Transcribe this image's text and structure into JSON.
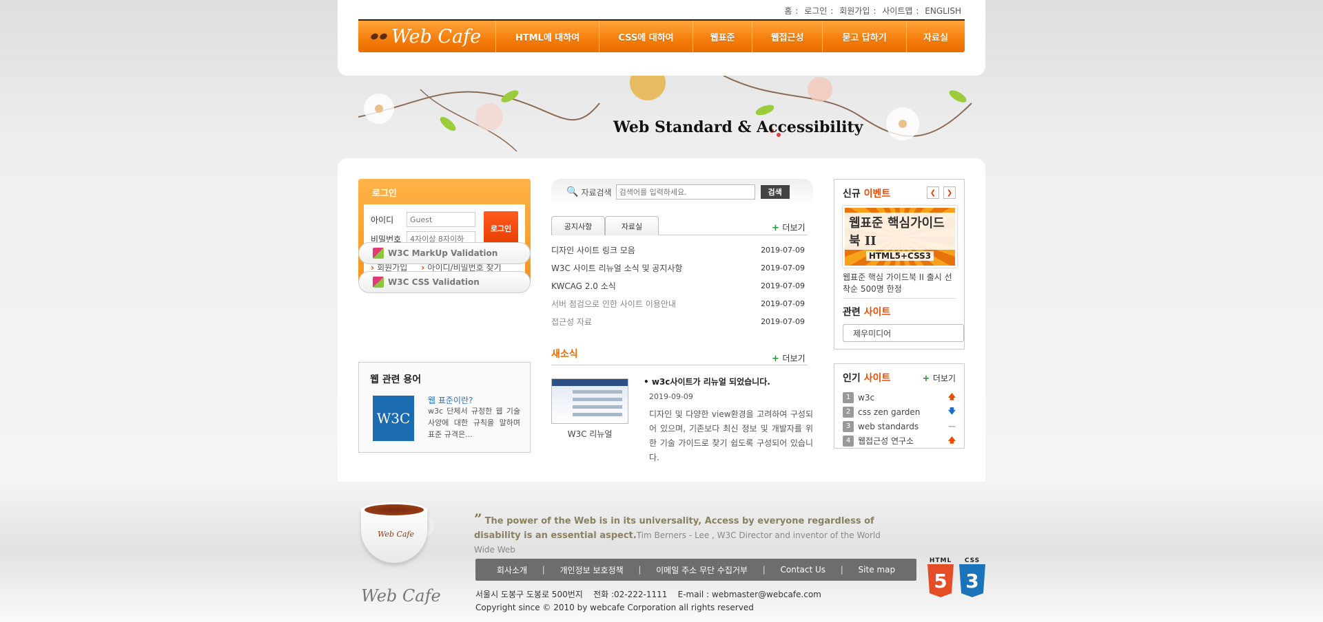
{
  "util_links": [
    "홈",
    "로그인",
    "회원가입",
    "사이트맵",
    "ENGLISH"
  ],
  "brand": "Web Cafe",
  "nav": [
    "HTML에 대하여",
    "CSS에 대하여",
    "웹표준",
    "웹접근성",
    "묻고 답하기",
    "자료실"
  ],
  "visual_title": "Web Standard & Accessibility",
  "login": {
    "title": "로그인",
    "id_label": "아이디",
    "id_placeholder": "Guest",
    "pw_label": "비밀번호",
    "pw_placeholder": "4자이상 8자이하",
    "button": "로그인",
    "join": "회원가입",
    "find": "아이디/비밀번호 찾기"
  },
  "validators": [
    "W3C MarkUp Validation",
    "W3C CSS Validation"
  ],
  "terms": {
    "title": "웹 관련 용어",
    "logo": "W3C",
    "item_title": "웹 표준이란?",
    "item_desc": "w3c 단체서 규정한 웹 기술 사양에 대한 규칙을 말하며 표준 규격은..."
  },
  "search": {
    "label": "자료검색",
    "placeholder": "검색어를 입력하세요.",
    "button": "검색"
  },
  "board": {
    "tabs": [
      "공지사항",
      "자료실"
    ],
    "more": "더보기",
    "items": [
      {
        "title": "디자인 사이트 링크 모음",
        "date": "2019-07-09"
      },
      {
        "title": "W3C 사이트 리뉴얼 소식 및 공지사항",
        "date": "2019-07-09"
      },
      {
        "title": "KWCAG 2.0 소식",
        "date": "2019-07-09"
      },
      {
        "title": "서버 점검으로 인한 사이트 이용안내",
        "date": "2019-07-09"
      },
      {
        "title": "접근성 자료",
        "date": "2019-07-09"
      }
    ]
  },
  "news": {
    "title": "새소식",
    "more": "더보기",
    "thumb_caption": "W3C 리뉴얼",
    "headline": "w3c사이트가 리뉴얼 되었습니다.",
    "date": "2019-09-09",
    "desc": "디자인 및 다양한 view환경을 고려하여 구성되어 있으며, 기존보다 최신 정보 및 개발자를 위한 기술 가이드로 찾기 쉽도록 구성되어 있습니다."
  },
  "event": {
    "title_a": "신규",
    "title_b": "이벤트",
    "book_title": "웹표준 핵심가이드북 II",
    "book_sub": "HTML5+CSS3",
    "caption": "웹표준 핵심 가이드북 II 출시 선착순 500명 한정"
  },
  "related": {
    "title_a": "관련",
    "title_b": "사이트",
    "selected": "제우미디어"
  },
  "popular": {
    "title_a": "인기",
    "title_b": "사이트",
    "more": "더보기",
    "items": [
      {
        "num": "1",
        "name": "w3c",
        "trend": "up"
      },
      {
        "num": "2",
        "name": "css zen garden",
        "trend": "down"
      },
      {
        "num": "3",
        "name": "web standards",
        "trend": "same"
      },
      {
        "num": "4",
        "name": "웹접근성 연구소",
        "trend": "up"
      }
    ]
  },
  "quote": {
    "mark": "”",
    "text": "The power of the Web is in its universality, Access by everyone regardless of disability is an essential aspect.",
    "author": "Tim Berners - Lee , W3C Director and inventor of the World Wide Web"
  },
  "cup_logo": "Web Cafe",
  "footer": {
    "links": [
      "회사소개",
      "개인정보 보호정책",
      "이메일 주소 무단 수집거부",
      "Contact Us",
      "Site map"
    ],
    "address": "서울시 도봉구 도봉로 500번지    전화 :02-222-1111    E-mail : webmaster@webcafe.com",
    "copyright": "Copyright since © 2010 by webcafe Corporation all rights reserved",
    "badge_html": "HTML",
    "badge_html_num": "5",
    "badge_css": "CSS",
    "badge_css_num": "3"
  },
  "colors": {
    "accent": "#f47d0b",
    "highlight": "#f04c00",
    "footer_nav": "#6d6d6d"
  }
}
